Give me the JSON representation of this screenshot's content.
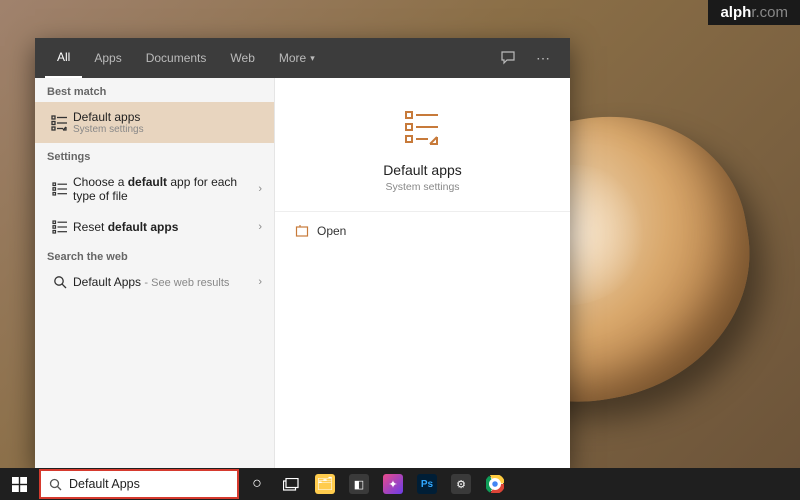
{
  "watermark": {
    "brand": "alph",
    "suffix": "r.com"
  },
  "tabs": {
    "all": "All",
    "apps": "Apps",
    "documents": "Documents",
    "web": "Web",
    "more": "More"
  },
  "sections": {
    "best_match": "Best match",
    "settings": "Settings",
    "search_web": "Search the web"
  },
  "best_match": {
    "title": "Default apps",
    "subtitle": "System settings"
  },
  "settings_items": [
    {
      "prefix": "Choose a ",
      "bold": "default",
      "suffix": " app for each type of file"
    },
    {
      "prefix": "Reset ",
      "bold": "default apps",
      "suffix": ""
    }
  ],
  "web_item": {
    "title": "Default Apps",
    "suffix_label": "See web results"
  },
  "preview": {
    "title": "Default apps",
    "subtitle": "System settings",
    "action_open": "Open"
  },
  "search_input": {
    "value": "Default Apps"
  },
  "taskbar_icons": {
    "cortana": "○",
    "taskview": "▭",
    "explorer": "📁",
    "edge": "e",
    "media": "🎵",
    "photoshop": "Ps",
    "settings": "⚙",
    "chrome": "◉"
  },
  "colors": {
    "accent": "#c77a3a",
    "selected_bg": "#e8d5bf",
    "highlight_border": "#d63a2e"
  }
}
